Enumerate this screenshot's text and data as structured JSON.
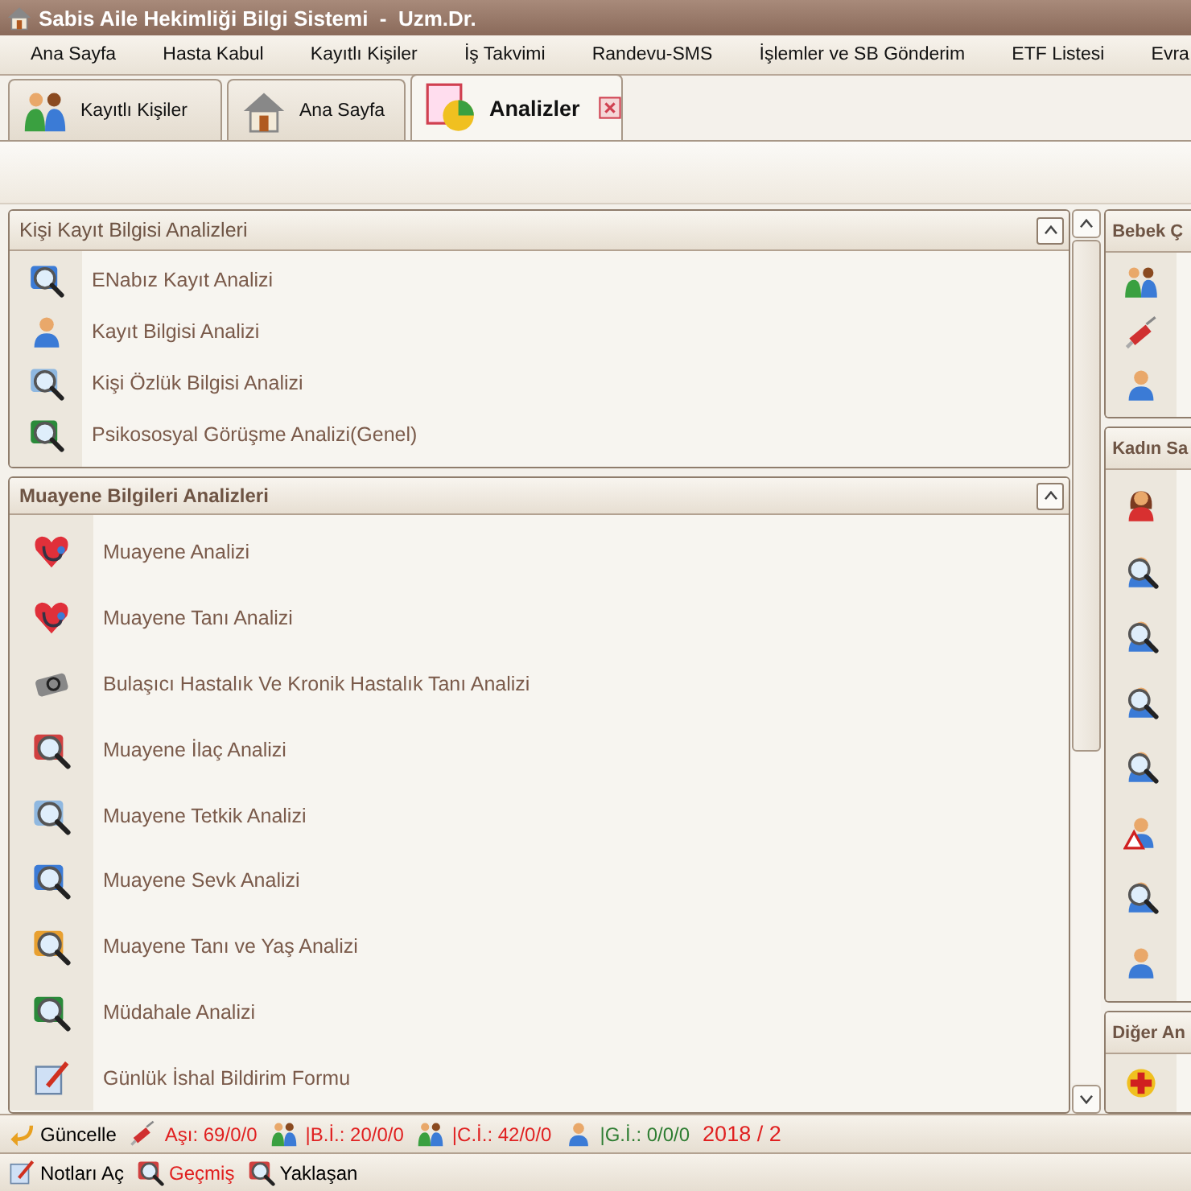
{
  "window": {
    "title": "Sabis Aile Hekimliği Bilgi Sistemi  -  Uzm.Dr."
  },
  "menu": [
    "Ana Sayfa",
    "Hasta Kabul",
    "Kayıtlı Kişiler",
    "İş Takvimi",
    "Randevu-SMS",
    "İşlemler ve SB Gönderim",
    "ETF Listesi",
    "Evra"
  ],
  "tabs": [
    {
      "label": "Kayıtlı Kişiler",
      "selected": false,
      "kind": "people"
    },
    {
      "label": "Ana Sayfa",
      "selected": false,
      "kind": "house"
    },
    {
      "label": "Analizler",
      "selected": true,
      "kind": "chart"
    }
  ],
  "groups": [
    {
      "title": "Kişi Kayıt Bilgisi Analizleri",
      "focused": false,
      "expanded": true,
      "items": [
        {
          "label": "ENabız Kayıt Analizi",
          "kind": "list-search"
        },
        {
          "label": "Kayıt Bilgisi Analizi",
          "kind": "person"
        },
        {
          "label": "Kişi Özlük Bilgisi Analizi",
          "kind": "card-search"
        },
        {
          "label": "Psikososyal Görüşme Analizi(Genel)",
          "kind": "chart-search"
        }
      ]
    },
    {
      "title": "Muayene Bilgileri Analizleri",
      "focused": true,
      "expanded": true,
      "items": [
        {
          "label": "Muayene Analizi",
          "kind": "heart"
        },
        {
          "label": "Muayene Tanı Analizi",
          "kind": "heart"
        },
        {
          "label": "Bulaşıcı Hastalık Ve Kronik Hastalık Tanı Analizi",
          "kind": "device"
        },
        {
          "label": "Muayene İlaç Analizi",
          "kind": "magnifier"
        },
        {
          "label": "Muayene Tetkik Analizi",
          "kind": "card-search"
        },
        {
          "label": "Muayene Sevk Analizi",
          "kind": "list-search"
        },
        {
          "label": "Muayene Tanı ve Yaş Analizi",
          "kind": "folder-search"
        },
        {
          "label": "Müdahale Analizi",
          "kind": "chart-search"
        },
        {
          "label": "Günlük İshal Bildirim Formu",
          "kind": "pen"
        }
      ]
    }
  ],
  "side_groups": [
    {
      "title": "Bebek Ç",
      "items": [
        {
          "kind": "people"
        },
        {
          "kind": "syringe"
        },
        {
          "kind": "person"
        }
      ]
    },
    {
      "title": "Kadın Sa",
      "items": [
        {
          "kind": "woman"
        },
        {
          "kind": "person-search"
        },
        {
          "kind": "person-search"
        },
        {
          "kind": "person-search"
        },
        {
          "kind": "person-search"
        },
        {
          "kind": "warning"
        },
        {
          "kind": "person-search"
        },
        {
          "kind": "person"
        }
      ]
    },
    {
      "title": "Diğer An",
      "items": [
        {
          "kind": "medkit"
        }
      ]
    }
  ],
  "status_bar": [
    {
      "text": "Güncelle",
      "kind": "button",
      "color": "#000000"
    },
    {
      "text": "Aşı: 69/0/0",
      "kind": "label",
      "color": "#e02020"
    },
    {
      "text": "|B.İ.: 20/0/0",
      "kind": "label",
      "color": "#e02020"
    },
    {
      "text": "|C.İ.: 42/0/0",
      "kind": "label",
      "color": "#e02020"
    },
    {
      "text": "|G.İ.: 0/0/0",
      "kind": "label",
      "color": "#2e7d32"
    },
    {
      "text": "2018 / 2",
      "kind": "label",
      "color": "#e02020"
    }
  ],
  "bottom_bar": [
    {
      "text": "Notları Aç",
      "color": "#000000"
    },
    {
      "text": "Geçmiş",
      "color": "#e02020"
    },
    {
      "text": "Yaklaşan",
      "color": "#000000"
    }
  ]
}
